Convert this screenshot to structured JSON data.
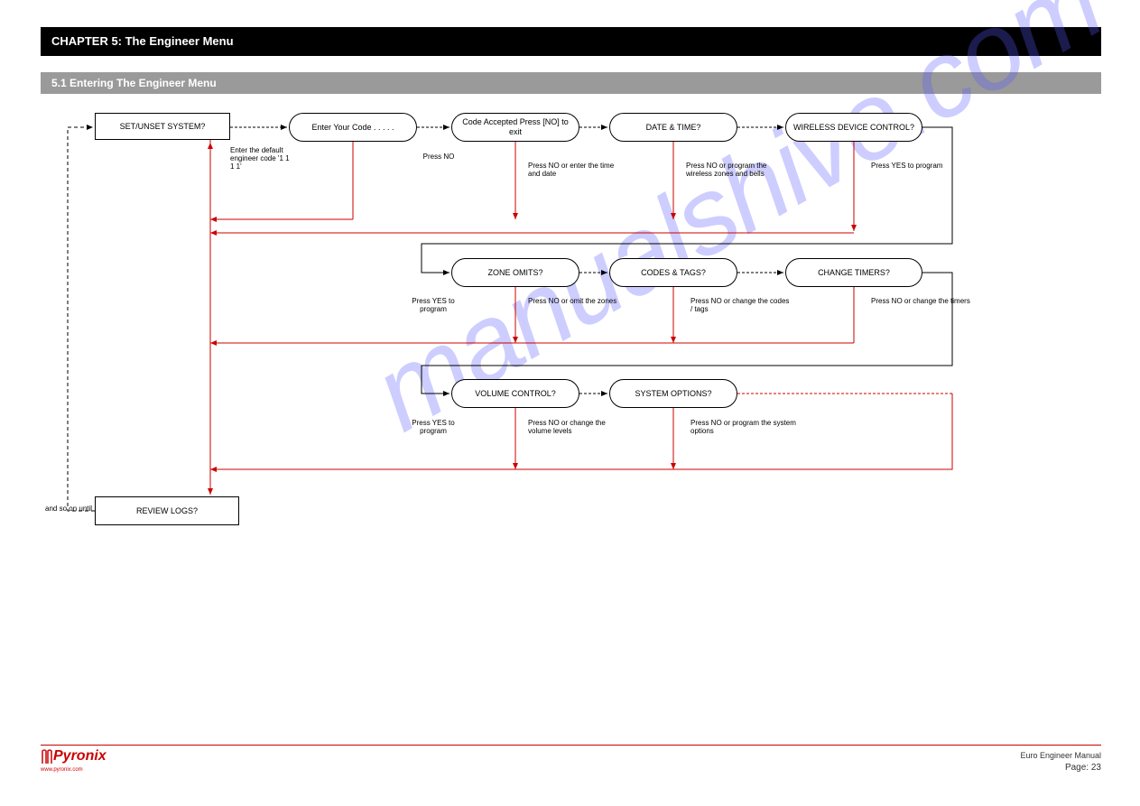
{
  "header": {
    "title": "CHAPTER 5: The Engineer Menu",
    "subtitle": "5.1 Entering The Engineer Menu"
  },
  "nodes": {
    "start_rect": "SET/UNSET SYSTEM?",
    "row1_a": "Enter Your Code . . . . .",
    "row1_b": "Code Accepted Press [NO] to exit",
    "row1_c": "DATE & TIME?",
    "row1_d": "WIRELESS DEVICE CONTROL?",
    "row2_a": "ZONE OMITS?",
    "row2_b": "CODES & TAGS?",
    "row2_c": "CHANGE TIMERS?",
    "row3_a": "VOLUME CONTROL?",
    "row3_b": "SYSTEM OPTIONS?",
    "end_rect": "REVIEW LOGS?"
  },
  "edges": {
    "edge1": "Enter the default engineer code '1 1 1 1'",
    "edge2": "Press NO",
    "edge3": "Press NO or enter the time and date",
    "edge4": "Press NO or program the wireless zones and bells",
    "edge5": "Press YES to program",
    "edge6": "Press NO or omit the zones",
    "edge7": "Press NO or change the codes / tags",
    "edge8": "Press NO or change the timers",
    "edge9": "Press YES to program",
    "edge10": "Press NO or change the volume levels",
    "edge11": "Press NO or program the system options",
    "edge12": "Press YES to program",
    "end_label": "and so on until"
  },
  "watermark": "manualshive.com",
  "footer": {
    "brand": "Pyronix",
    "brand_sub": "www.pyronix.com",
    "right": "Euro Engineer Manual",
    "page": "Page: 23"
  }
}
